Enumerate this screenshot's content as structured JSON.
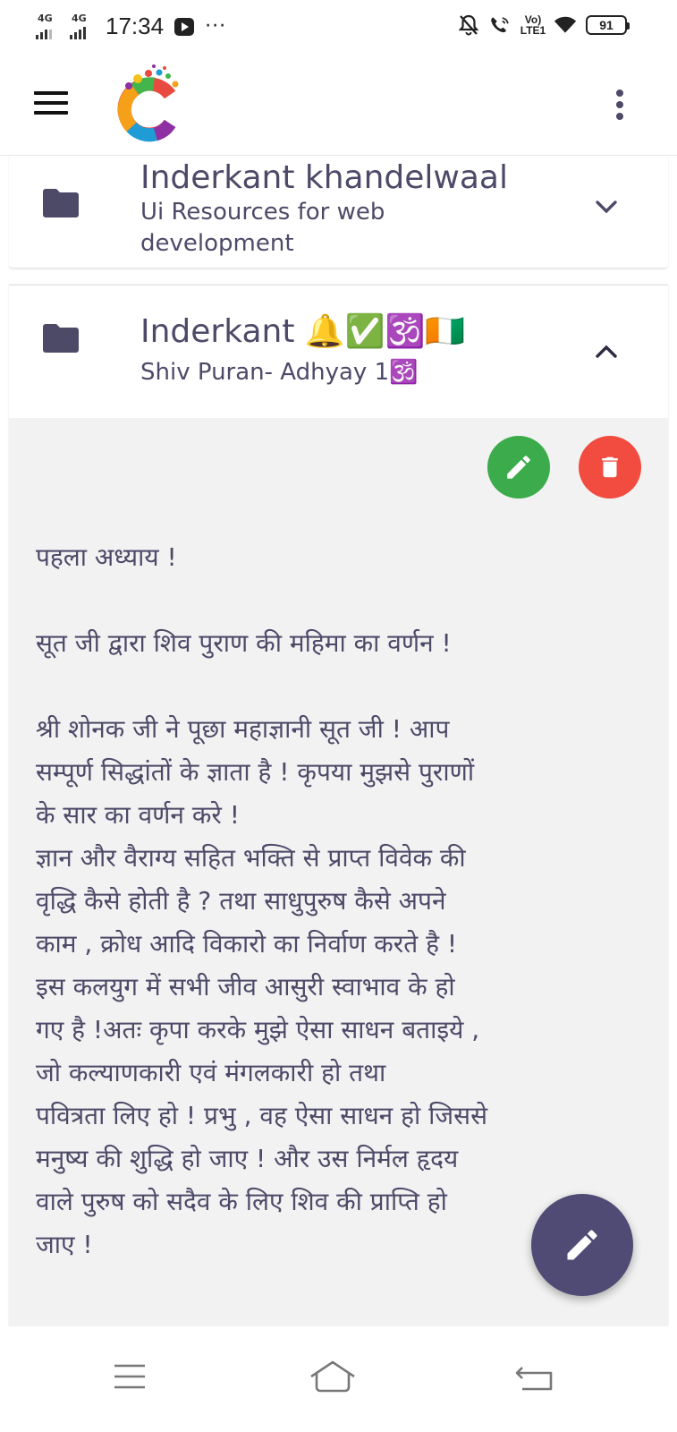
{
  "status_bar": {
    "signal_1_label": "4G",
    "signal_2_label": "4G",
    "time": "17:34",
    "overflow": "···",
    "lte_top": "Vo)",
    "lte_bottom": "LTE1",
    "battery": "91",
    "icons": [
      "youtube-notification-icon",
      "bell-off-icon",
      "wifi-call-icon",
      "lte-icon",
      "wifi-icon",
      "battery-icon"
    ]
  },
  "app_bar": {
    "icons": [
      "hamburger-menu-icon",
      "app-logo",
      "more-vert-icon"
    ]
  },
  "notes": [
    {
      "title": "Inderkant khandelwaal",
      "subtitle": "Ui Resources for web development",
      "expanded": false,
      "icon": "folder-icon",
      "toggle_icon": "chevron-down-icon"
    },
    {
      "title": "Inderkant 🔔✅🕉️🇨🇮",
      "subtitle": "Shiv Puran- Adhyay 1🕉️",
      "expanded": true,
      "icon": "folder-icon",
      "toggle_icon": "chevron-up-icon",
      "actions": [
        "edit-icon",
        "delete-icon"
      ],
      "body": {
        "para1": "पहला अध्याय !",
        "para2": "सूत जी द्वारा शिव पुराण की महिमा का वर्णन !",
        "para3_line1": "श्री शोनक जी ने पूछा महाज्ञानी सूत जी ! आप",
        "para3_line2": "सम्पूर्ण सिद्धांतों के ज्ञाता है ! कृपया मुझसे पुराणों",
        "para3_line3": "के सार का वर्णन करे !",
        "para3_line4": "ज्ञान और वैराग्य सहित भक्ति से प्राप्त विवेक की",
        "para3_line5": "वृद्धि कैसे होती है ? तथा साधुपुरुष कैसे अपने",
        "para3_line6": "काम , क्रोध आदि विकारो का निर्वाण करते है !",
        "para3_line7": "इस कलयुग में सभी जीव आसुरी स्वाभाव के हो",
        "para3_line8": "गए है !अतः कृपा करके मुझे ऐसा साधन बताइये ,",
        "para3_line9": "जो कल्याणकारी एवं मंगलकारी हो तथा",
        "para3_line10": "पवित्रता लिए हो ! प्रभु , वह ऐसा साधन हो जिससे",
        "para3_line11": "मनुष्य की शुद्धि हो जाए ! और उस निर्मल हृदय",
        "para3_line12": "वाले पुरुष को सदैव के लिए शिव की प्राप्ति हो",
        "para3_line13": "जाए !"
      }
    }
  ],
  "fab": {
    "icon": "edit-icon"
  },
  "nav_bar": {
    "icons": [
      "recents-menu-icon",
      "home-icon",
      "back-icon"
    ]
  },
  "colors": {
    "primary": "#4d4a68",
    "fab": "#4f4b74",
    "edit": "#3bab4b",
    "delete": "#f24b3f",
    "body_bg": "#f2f2f2"
  }
}
